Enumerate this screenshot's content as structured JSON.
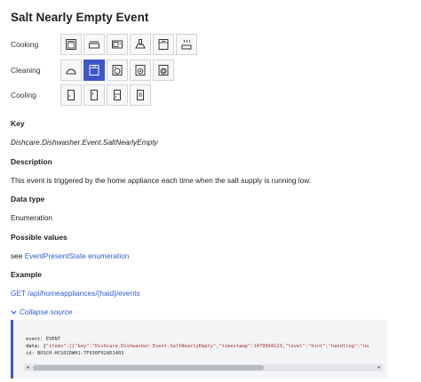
{
  "page": {
    "title": "Salt Nearly Empty Event"
  },
  "categories": [
    {
      "label": "Cooking",
      "tiles": [
        {
          "icon": "oven-icon"
        },
        {
          "icon": "cooktop-icon"
        },
        {
          "icon": "microwave-icon"
        },
        {
          "icon": "hood-icon"
        },
        {
          "icon": "warming-drawer-icon"
        },
        {
          "icon": "coffee-steam-icon"
        }
      ]
    },
    {
      "label": "Cleaning",
      "tiles": [
        {
          "icon": "robot-vacuum-icon"
        },
        {
          "icon": "dishwasher-icon",
          "active": true
        },
        {
          "icon": "washer-icon"
        },
        {
          "icon": "dryer-icon"
        },
        {
          "icon": "washer-dryer-icon"
        }
      ]
    },
    {
      "label": "Cooling",
      "tiles": [
        {
          "icon": "fridge-icon"
        },
        {
          "icon": "freezer-icon"
        },
        {
          "icon": "fridge-freezer-icon"
        },
        {
          "icon": "wine-cooler-icon"
        }
      ]
    }
  ],
  "sections": {
    "key_title": "Key",
    "key_value": "Dishcare.Dishwasher.Event.SaltNearlyEmpty",
    "description_title": "Description",
    "description_text": "This event is triggered by the home appliance each time when the salt supply is running low.",
    "datatype_title": "Data type",
    "datatype_value": "Enumeration",
    "possible_title": "Possible values",
    "possible_prefix": "see ",
    "possible_link": "EventPresentState enumeration",
    "example_title": "Example",
    "example_link": "GET /api/homeappliances/{haid}/events",
    "collapse_label": "Collapse source"
  },
  "code": {
    "line1": "event: EVENT",
    "line2_prefix": "data: {",
    "line2_rest": "\"items\":[{\"key\":\"Dishcare.Dishwasher.Event.SaltNearlyEmpty\",\"timestamp\":1479994113,\"level\":\"hint\",\"handling\":\"no",
    "line3": "id: BOSCH-HCS02DWH1-7F930F92AD1403"
  },
  "colors": {
    "accent": "#3d56c8",
    "link": "#2f5bd3"
  }
}
